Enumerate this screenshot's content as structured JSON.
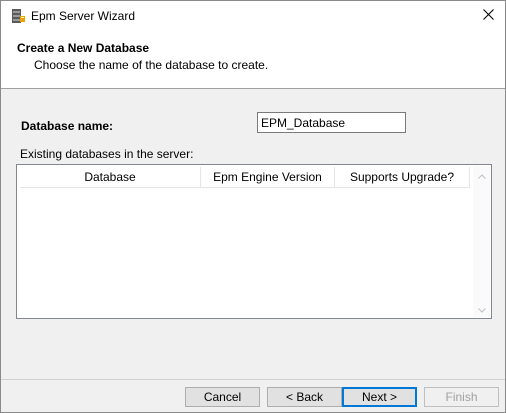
{
  "window": {
    "title": "Epm Server Wizard",
    "app_icon": "server-icon",
    "close_icon": "close-icon"
  },
  "header": {
    "title": "Create a New Database",
    "subtitle": "Choose the name of the database to create."
  },
  "form": {
    "db_name_label": "Database name:",
    "db_name_value": "EPM_Database",
    "existing_label": "Existing databases in the server:"
  },
  "table": {
    "columns": [
      "Database",
      "Epm Engine Version",
      "Supports Upgrade?"
    ],
    "rows": []
  },
  "buttons": {
    "cancel": "Cancel",
    "back": "< Back",
    "next": "Next >",
    "finish": "Finish"
  },
  "colors": {
    "accent": "#0078d7"
  }
}
